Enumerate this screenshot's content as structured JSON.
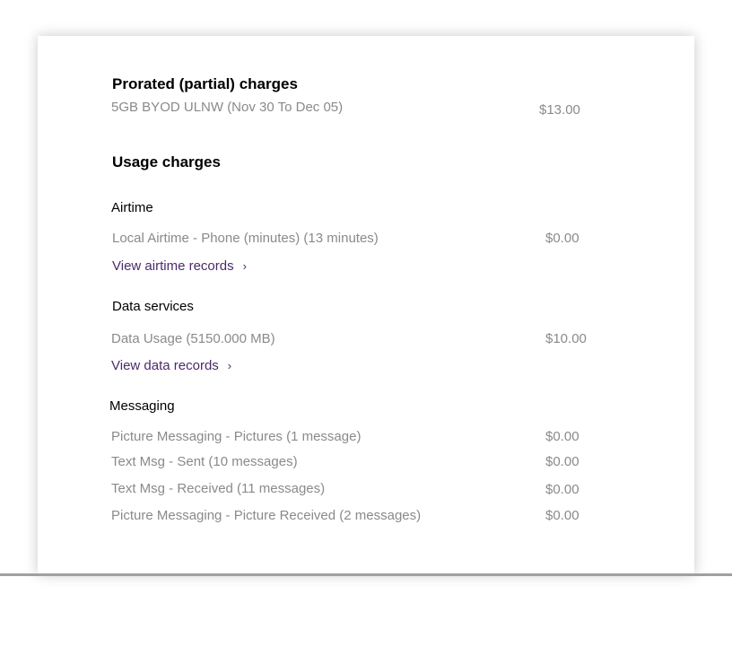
{
  "prorated": {
    "title": "Prorated (partial) charges",
    "items": [
      {
        "label": "5GB BYOD ULNW (Nov 30 To Dec 05)",
        "amount": "$13.00"
      }
    ]
  },
  "usage": {
    "title": "Usage charges",
    "airtime": {
      "title": "Airtime",
      "items": [
        {
          "label": "Local Airtime - Phone (minutes) (13 minutes)",
          "amount": "$0.00"
        }
      ],
      "link_label": "View airtime records"
    },
    "data_services": {
      "title": "Data services",
      "items": [
        {
          "label": "Data Usage (5150.000 MB)",
          "amount": "$10.00"
        }
      ],
      "link_label": "View data records"
    },
    "messaging": {
      "title": "Messaging",
      "items": [
        {
          "label": "Picture Messaging - Pictures (1 message)",
          "amount": "$0.00"
        },
        {
          "label": "Text Msg - Sent (10 messages)",
          "amount": "$0.00"
        },
        {
          "label": "Text Msg - Received (11 messages)",
          "amount": "$0.00"
        },
        {
          "label": "Picture Messaging - Picture Received (2 messages)",
          "amount": "$0.00"
        }
      ]
    }
  },
  "icons": {
    "chevron": "›",
    "chevron_name": "chevron-right-icon"
  },
  "colors": {
    "link": "#4b2a6b",
    "muted_text": "#8a8a8a",
    "heading": "#000000"
  }
}
